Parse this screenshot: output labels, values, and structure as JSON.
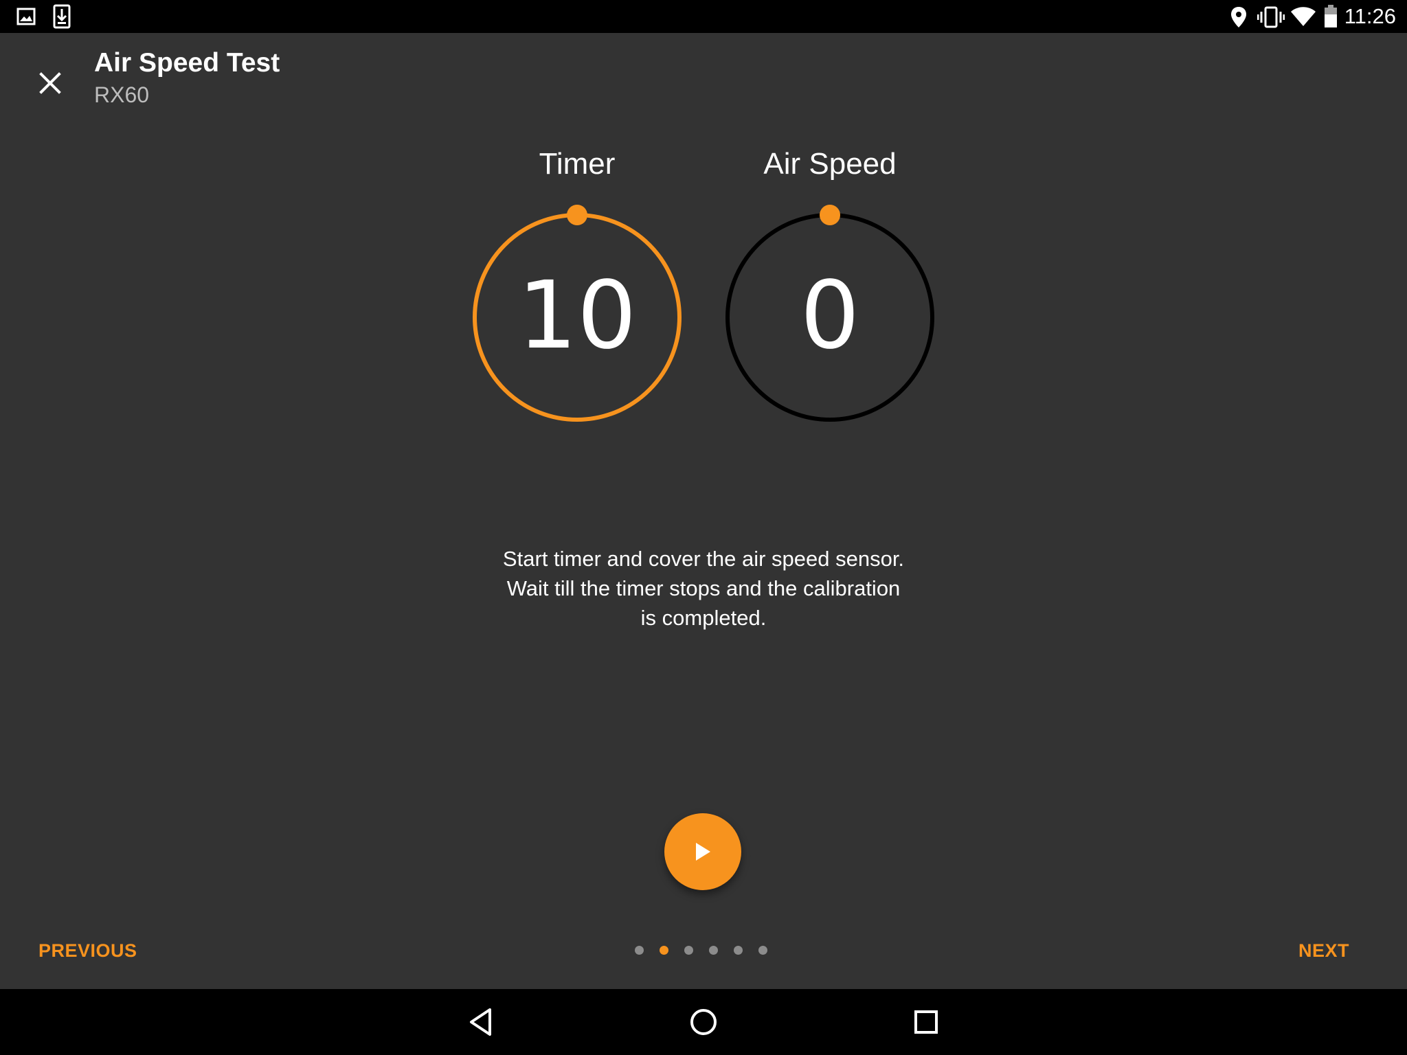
{
  "status_bar": {
    "time": "11:26",
    "left_icons": [
      "image-icon",
      "download-icon"
    ],
    "right_icons": [
      "location-icon",
      "vibrate-icon",
      "wifi-icon",
      "battery-icon"
    ]
  },
  "app_bar": {
    "title": "Air Speed Test",
    "subtitle": "RX60",
    "close_icon": "close-icon"
  },
  "gauges": {
    "timer": {
      "label": "Timer",
      "value": "10",
      "ring_color": "#f7931e",
      "progress": 1.0
    },
    "air_speed": {
      "label": "Air Speed",
      "value": "0",
      "ring_color": "#000000",
      "progress": 0.0
    }
  },
  "instructions": "Start timer and cover the air speed sensor. Wait till the timer stops and the calibration is completed.",
  "fab": {
    "icon": "play-icon"
  },
  "footer": {
    "previous_label": "PREVIOUS",
    "next_label": "NEXT",
    "page_count": 6,
    "current_page": 2
  },
  "colors": {
    "accent": "#f7931e",
    "background": "#333333",
    "bar": "#000000"
  },
  "nav_bar": {
    "icons": [
      "back-icon",
      "home-icon",
      "recents-icon"
    ]
  }
}
